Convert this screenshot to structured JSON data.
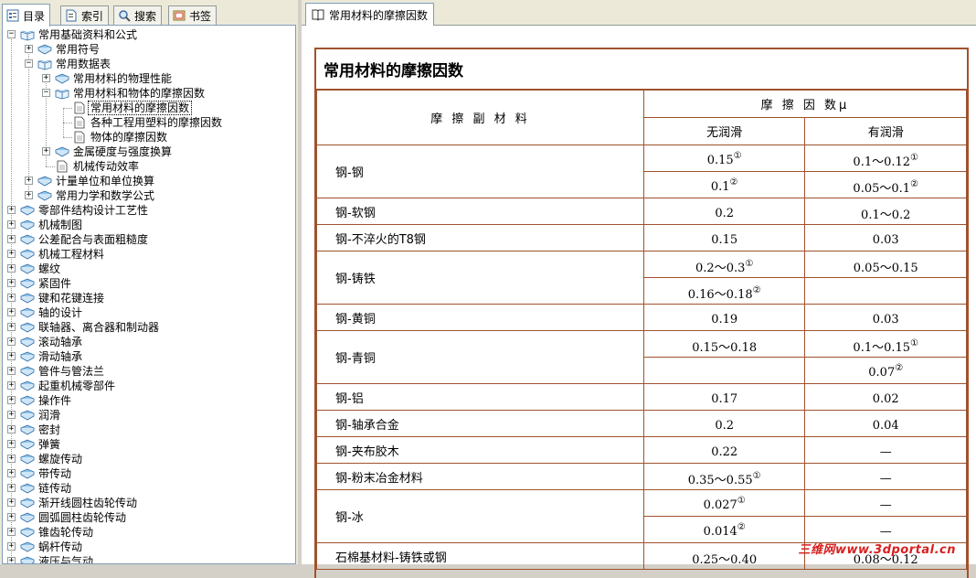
{
  "left_tabs": [
    {
      "label": "目录",
      "icon": "toc-icon"
    },
    {
      "label": "索引",
      "icon": "index-icon"
    },
    {
      "label": "搜索",
      "icon": "search-icon"
    },
    {
      "label": "书签",
      "icon": "bookmark-icon"
    }
  ],
  "tree": {
    "items": [
      {
        "label": "常用基础资料和公式",
        "level": 0,
        "expander": "−",
        "icon": "book-open"
      },
      {
        "label": "常用符号",
        "level": 1,
        "expander": "+",
        "icon": "book"
      },
      {
        "label": "常用数据表",
        "level": 1,
        "expander": "−",
        "icon": "book-open"
      },
      {
        "label": "常用材料的物理性能",
        "level": 2,
        "expander": "+",
        "icon": "book"
      },
      {
        "label": "常用材料和物体的摩擦因数",
        "level": 2,
        "expander": "−",
        "icon": "book-open"
      },
      {
        "label": "常用材料的摩擦因数",
        "level": 3,
        "expander": "",
        "icon": "page",
        "selected": true
      },
      {
        "label": "各种工程用塑料的摩擦因数",
        "level": 3,
        "expander": "",
        "icon": "page"
      },
      {
        "label": "物体的摩擦因数",
        "level": 3,
        "expander": "",
        "icon": "page"
      },
      {
        "label": "金属硬度与强度换算",
        "level": 2,
        "expander": "+",
        "icon": "book"
      },
      {
        "label": "机械传动效率",
        "level": 2,
        "expander": "",
        "icon": "page"
      },
      {
        "label": "计量单位和单位换算",
        "level": 1,
        "expander": "+",
        "icon": "book"
      },
      {
        "label": "常用力学和数学公式",
        "level": 1,
        "expander": "+",
        "icon": "book"
      },
      {
        "label": "零部件结构设计工艺性",
        "level": 0,
        "expander": "+",
        "icon": "book"
      },
      {
        "label": "机械制图",
        "level": 0,
        "expander": "+",
        "icon": "book"
      },
      {
        "label": "公差配合与表面粗糙度",
        "level": 0,
        "expander": "+",
        "icon": "book"
      },
      {
        "label": "机械工程材料",
        "level": 0,
        "expander": "+",
        "icon": "book"
      },
      {
        "label": "螺纹",
        "level": 0,
        "expander": "+",
        "icon": "book"
      },
      {
        "label": "紧固件",
        "level": 0,
        "expander": "+",
        "icon": "book"
      },
      {
        "label": "键和花键连接",
        "level": 0,
        "expander": "+",
        "icon": "book"
      },
      {
        "label": "轴的设计",
        "level": 0,
        "expander": "+",
        "icon": "book"
      },
      {
        "label": "联轴器、离合器和制动器",
        "level": 0,
        "expander": "+",
        "icon": "book"
      },
      {
        "label": "滚动轴承",
        "level": 0,
        "expander": "+",
        "icon": "book"
      },
      {
        "label": "滑动轴承",
        "level": 0,
        "expander": "+",
        "icon": "book"
      },
      {
        "label": "管件与管法兰",
        "level": 0,
        "expander": "+",
        "icon": "book"
      },
      {
        "label": "起重机械零部件",
        "level": 0,
        "expander": "+",
        "icon": "book"
      },
      {
        "label": "操作件",
        "level": 0,
        "expander": "+",
        "icon": "book"
      },
      {
        "label": "润滑",
        "level": 0,
        "expander": "+",
        "icon": "book"
      },
      {
        "label": "密封",
        "level": 0,
        "expander": "+",
        "icon": "book"
      },
      {
        "label": "弹簧",
        "level": 0,
        "expander": "+",
        "icon": "book"
      },
      {
        "label": "螺旋传动",
        "level": 0,
        "expander": "+",
        "icon": "book"
      },
      {
        "label": "带传动",
        "level": 0,
        "expander": "+",
        "icon": "book"
      },
      {
        "label": "链传动",
        "level": 0,
        "expander": "+",
        "icon": "book"
      },
      {
        "label": "渐开线圆柱齿轮传动",
        "level": 0,
        "expander": "+",
        "icon": "book"
      },
      {
        "label": "圆弧圆柱齿轮传动",
        "level": 0,
        "expander": "+",
        "icon": "book"
      },
      {
        "label": "锥齿轮传动",
        "level": 0,
        "expander": "+",
        "icon": "book"
      },
      {
        "label": "蜗杆传动",
        "level": 0,
        "expander": "+",
        "icon": "book"
      },
      {
        "label": "液压与气动",
        "level": 0,
        "expander": "+",
        "icon": "book"
      }
    ]
  },
  "right_tab": {
    "label": "常用材料的摩擦因数",
    "icon": "page-book-icon"
  },
  "doc": {
    "title": "常用材料的摩擦因数",
    "header": {
      "material": "摩 擦 副 材 料",
      "coef": "摩 擦 因 数μ",
      "dry": "无润滑",
      "lub": "有润滑"
    },
    "rows": [
      {
        "material": "钢-钢",
        "sub": [
          {
            "dry": "0.15",
            "dry_note": "①",
            "lub": "0.1～0.12",
            "lub_note": "①"
          },
          {
            "dry": "0.1",
            "dry_note": "②",
            "lub": "0.05～0.1",
            "lub_note": "②"
          }
        ]
      },
      {
        "material": "钢-软钢",
        "sub": [
          {
            "dry": "0.2",
            "dry_note": "",
            "lub": "0.1～0.2",
            "lub_note": ""
          }
        ]
      },
      {
        "material": "钢-不淬火的T8钢",
        "sub": [
          {
            "dry": "0.15",
            "dry_note": "",
            "lub": "0.03",
            "lub_note": ""
          }
        ]
      },
      {
        "material": "钢-铸铁",
        "sub": [
          {
            "dry": "0.2～0.3",
            "dry_note": "①",
            "lub": "0.05～0.15",
            "lub_note": ""
          },
          {
            "dry": "0.16～0.18",
            "dry_note": "②",
            "lub": "",
            "lub_note": ""
          }
        ]
      },
      {
        "material": "钢-黄铜",
        "sub": [
          {
            "dry": "0.19",
            "dry_note": "",
            "lub": "0.03",
            "lub_note": ""
          }
        ]
      },
      {
        "material": "钢-青铜",
        "sub": [
          {
            "dry": "0.15～0.18",
            "dry_note": "",
            "lub": "0.1～0.15",
            "lub_note": "①"
          },
          {
            "dry": "",
            "dry_note": "",
            "lub": "0.07",
            "lub_note": "②"
          }
        ]
      },
      {
        "material": "钢-铝",
        "sub": [
          {
            "dry": "0.17",
            "dry_note": "",
            "lub": "0.02",
            "lub_note": ""
          }
        ]
      },
      {
        "material": "钢-轴承合金",
        "sub": [
          {
            "dry": "0.2",
            "dry_note": "",
            "lub": "0.04",
            "lub_note": ""
          }
        ]
      },
      {
        "material": "钢-夹布胶木",
        "sub": [
          {
            "dry": "0.22",
            "dry_note": "",
            "lub": "—",
            "lub_note": ""
          }
        ]
      },
      {
        "material": "钢-粉末冶金材料",
        "sub": [
          {
            "dry": "0.35～0.55",
            "dry_note": "①",
            "lub": "—",
            "lub_note": ""
          }
        ]
      },
      {
        "material": "钢-冰",
        "sub": [
          {
            "dry": "0.027",
            "dry_note": "①",
            "lub": "—",
            "lub_note": ""
          },
          {
            "dry": "0.014",
            "dry_note": "②",
            "lub": "—",
            "lub_note": ""
          }
        ]
      },
      {
        "material": "石棉基材料-铸铁或钢",
        "sub": [
          {
            "dry": "0.25～0.40",
            "dry_note": "",
            "lub": "0.08～0.12",
            "lub_note": ""
          }
        ]
      }
    ]
  },
  "watermark": "三维网www.3dportal.cn",
  "colors": {
    "border": "#a0522d",
    "watermark": "#d82020",
    "tab_border": "#7f9db9"
  }
}
